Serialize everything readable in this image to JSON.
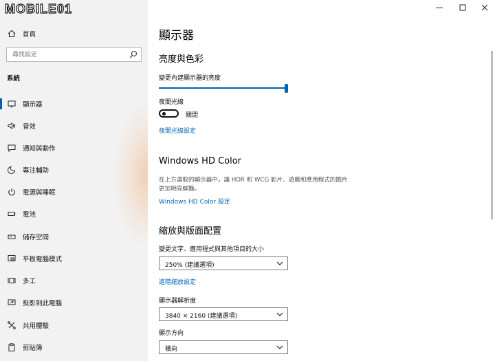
{
  "logo": {
    "text": "MOBILE01"
  },
  "nav": {
    "home_label": "首頁",
    "search_placeholder": "尋找設定",
    "section_heading": "系統",
    "items": [
      {
        "label": "顯示器",
        "icon": "monitor-icon"
      },
      {
        "label": "音效",
        "icon": "speaker-icon"
      },
      {
        "label": "通知與動作",
        "icon": "notification-icon"
      },
      {
        "label": "專注輔助",
        "icon": "moon-icon"
      },
      {
        "label": "電源與睡眠",
        "icon": "power-icon"
      },
      {
        "label": "電池",
        "icon": "battery-icon"
      },
      {
        "label": "儲存空間",
        "icon": "storage-icon"
      },
      {
        "label": "平板電腦模式",
        "icon": "tablet-mode-icon"
      },
      {
        "label": "多工",
        "icon": "multitask-icon"
      },
      {
        "label": "投影到此電腦",
        "icon": "project-icon"
      },
      {
        "label": "共用體驗",
        "icon": "shared-experience-icon"
      },
      {
        "label": "剪貼簿",
        "icon": "clipboard-icon"
      }
    ]
  },
  "window": {
    "controls": [
      "minimize",
      "maximize",
      "close"
    ]
  },
  "main": {
    "title": "顯示器",
    "brightness": {
      "heading": "亮度與色彩",
      "slider_label": "變更內建顯示器的亮度",
      "slider_value": 1.0,
      "night_light_label": "夜間光線",
      "night_light_state": "關閉",
      "night_light_link": "夜間光線設定"
    },
    "hdr": {
      "heading": "Windows HD Color",
      "desc_line1": "在上方選取的顯示器中，讓 HDR 和 WCG 影片、遊戲和應用程式的圖片",
      "desc_line2": "更加明亮鮮豔。",
      "link": "Windows HD Color 設定"
    },
    "scale": {
      "heading": "縮放與版面配置",
      "scale_label": "變更文字、應用程式與其他項目的大小",
      "scale_value": "250% (建議選項)",
      "advanced_link": "進階縮放設定",
      "resolution_label": "顯示器解析度",
      "resolution_value": "3840 × 2160 (建議選項)",
      "orientation_label": "顯示方向",
      "orientation_value": "橫向"
    }
  },
  "colors": {
    "accent": "#0063b1",
    "link": "#0066b4",
    "sidebar_bg": "#f2f2f2"
  }
}
